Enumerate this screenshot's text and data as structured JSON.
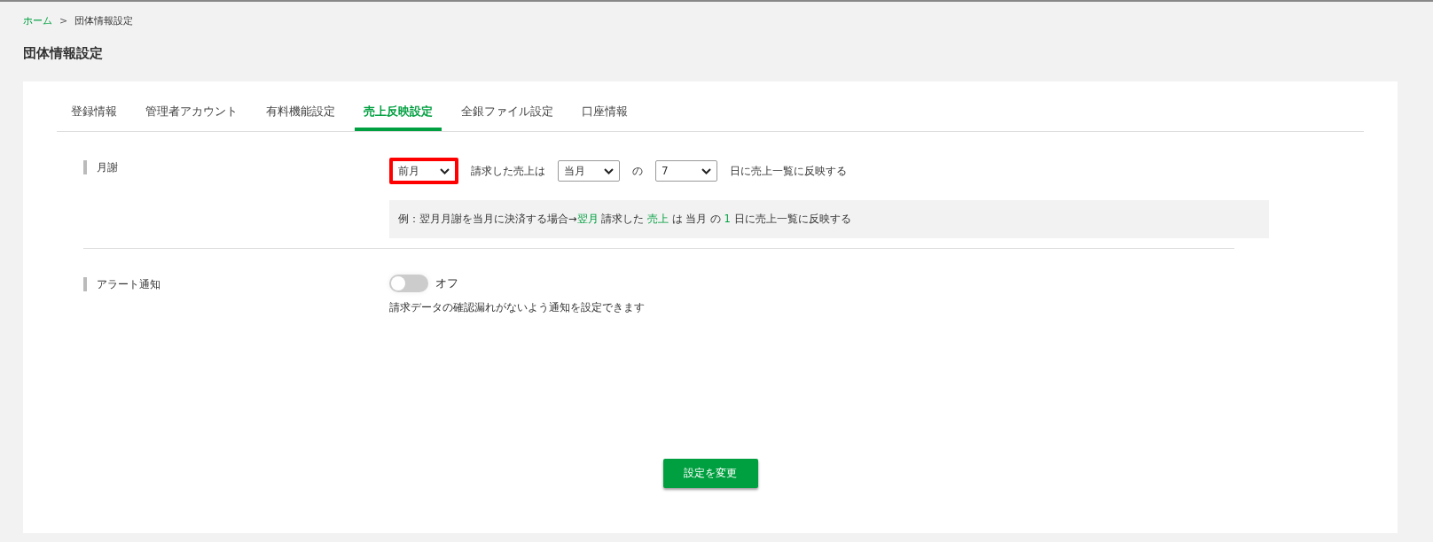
{
  "breadcrumb": [
    {
      "label": "ホーム",
      "link": true
    },
    {
      "label": "団体情報設定",
      "link": false
    }
  ],
  "breadcrumb_separator": ">",
  "page_title": "団体情報設定",
  "tabs": [
    {
      "label": "登録情報",
      "selected": false
    },
    {
      "label": "管理者アカウント",
      "selected": false
    },
    {
      "label": "有料機能設定",
      "selected": false
    },
    {
      "label": "売上反映設定",
      "selected": true
    },
    {
      "label": "全銀ファイル設定",
      "selected": false
    },
    {
      "label": "口座情報",
      "selected": false
    }
  ],
  "monthly": {
    "label": "月謝",
    "controls": [
      {
        "kind": "select",
        "value": "前月",
        "highlighted": true
      },
      {
        "kind": "text",
        "text": "請求した売上は"
      },
      {
        "kind": "select",
        "value": "当月",
        "highlighted": false
      },
      {
        "kind": "text",
        "text": "の"
      },
      {
        "kind": "select",
        "value": "7",
        "highlighted": false
      },
      {
        "kind": "text",
        "text": "日に売上一覧に反映する"
      }
    ],
    "example": [
      {
        "text": "例：翌月月謝を当月に決済する場合→",
        "highlight": false
      },
      {
        "text": "翌月",
        "highlight": true
      },
      {
        "text": "請求した",
        "highlight": false
      },
      {
        "text": "売上",
        "highlight": true
      },
      {
        "text": "は",
        "highlight": false
      },
      {
        "text": "当月",
        "highlight": false
      },
      {
        "text": "の",
        "highlight": false
      },
      {
        "text": "1",
        "highlight": true
      },
      {
        "text": "日に売上一覧に反映する",
        "highlight": false
      }
    ]
  },
  "alert": {
    "label": "アラート通知",
    "on": false,
    "state_text": "オフ",
    "description": "請求データの確認漏れがないよう通知を設定できます"
  },
  "submit_button": "設定を変更"
}
